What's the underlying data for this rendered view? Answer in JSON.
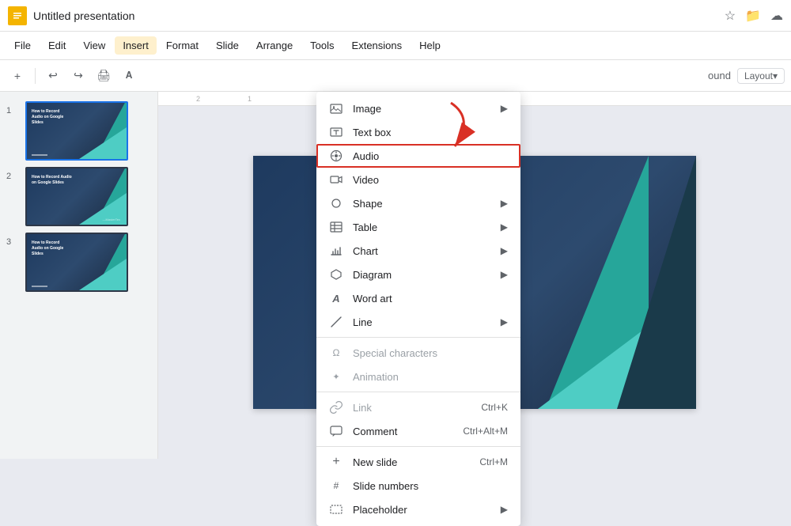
{
  "window": {
    "title": "Untitled presentation",
    "app_icon_label": "G"
  },
  "title_bar": {
    "title": "Untitled presentation",
    "icons": [
      "star",
      "folder",
      "cloud"
    ]
  },
  "menu": {
    "items": [
      "File",
      "Edit",
      "View",
      "Insert",
      "Format",
      "Slide",
      "Arrange",
      "Tools",
      "Extensions",
      "Help"
    ],
    "active_index": 3
  },
  "toolbar": {
    "buttons": [
      "+",
      "↩",
      "↪",
      "🖨",
      "A"
    ],
    "right_text": "ound",
    "layout_label": "Layout▾"
  },
  "slides": [
    {
      "number": "1",
      "label": "How to Record Audio on Google Slides"
    },
    {
      "number": "2",
      "label": "How to Record Audio on Google Slides"
    },
    {
      "number": "3",
      "label": "How to Record Audio on Google Slides"
    }
  ],
  "dropdown": {
    "items": [
      {
        "id": "image",
        "icon": "🖼",
        "label": "Image",
        "has_arrow": true,
        "disabled": false
      },
      {
        "id": "textbox",
        "icon": "T",
        "label": "Text box",
        "has_arrow": false,
        "disabled": false
      },
      {
        "id": "audio",
        "icon": "♪",
        "label": "Audio",
        "has_arrow": false,
        "disabled": false,
        "highlighted": true
      },
      {
        "id": "video",
        "icon": "▶",
        "label": "Video",
        "has_arrow": false,
        "disabled": false
      },
      {
        "id": "shape",
        "icon": "◇",
        "label": "Shape",
        "has_arrow": true,
        "disabled": false
      },
      {
        "id": "table",
        "icon": "▦",
        "label": "Table",
        "has_arrow": true,
        "disabled": false
      },
      {
        "id": "chart",
        "icon": "📊",
        "label": "Chart",
        "has_arrow": true,
        "disabled": false
      },
      {
        "id": "diagram",
        "icon": "⬡",
        "label": "Diagram",
        "has_arrow": true,
        "disabled": false
      },
      {
        "id": "wordart",
        "icon": "A",
        "label": "Word art",
        "has_arrow": false,
        "disabled": false
      },
      {
        "id": "line",
        "icon": "╱",
        "label": "Line",
        "has_arrow": true,
        "disabled": false
      },
      {
        "id": "sep1"
      },
      {
        "id": "special",
        "icon": "Ω",
        "label": "Special characters",
        "has_arrow": false,
        "disabled": true
      },
      {
        "id": "animation",
        "icon": "✦",
        "label": "Animation",
        "has_arrow": false,
        "disabled": true
      },
      {
        "id": "sep2"
      },
      {
        "id": "link",
        "icon": "🔗",
        "label": "Link",
        "shortcut": "Ctrl+K",
        "disabled": true
      },
      {
        "id": "comment",
        "icon": "💬",
        "label": "Comment",
        "shortcut": "Ctrl+Alt+M",
        "disabled": false
      },
      {
        "id": "sep3"
      },
      {
        "id": "newslide",
        "icon": "+",
        "label": "New slide",
        "shortcut": "Ctrl+M",
        "disabled": false
      },
      {
        "id": "slidenumbers",
        "icon": "#",
        "label": "Slide numbers",
        "has_arrow": false,
        "disabled": false
      },
      {
        "id": "placeholder",
        "icon": "⬚",
        "label": "Placeholder",
        "has_arrow": true,
        "disabled": false
      }
    ]
  }
}
